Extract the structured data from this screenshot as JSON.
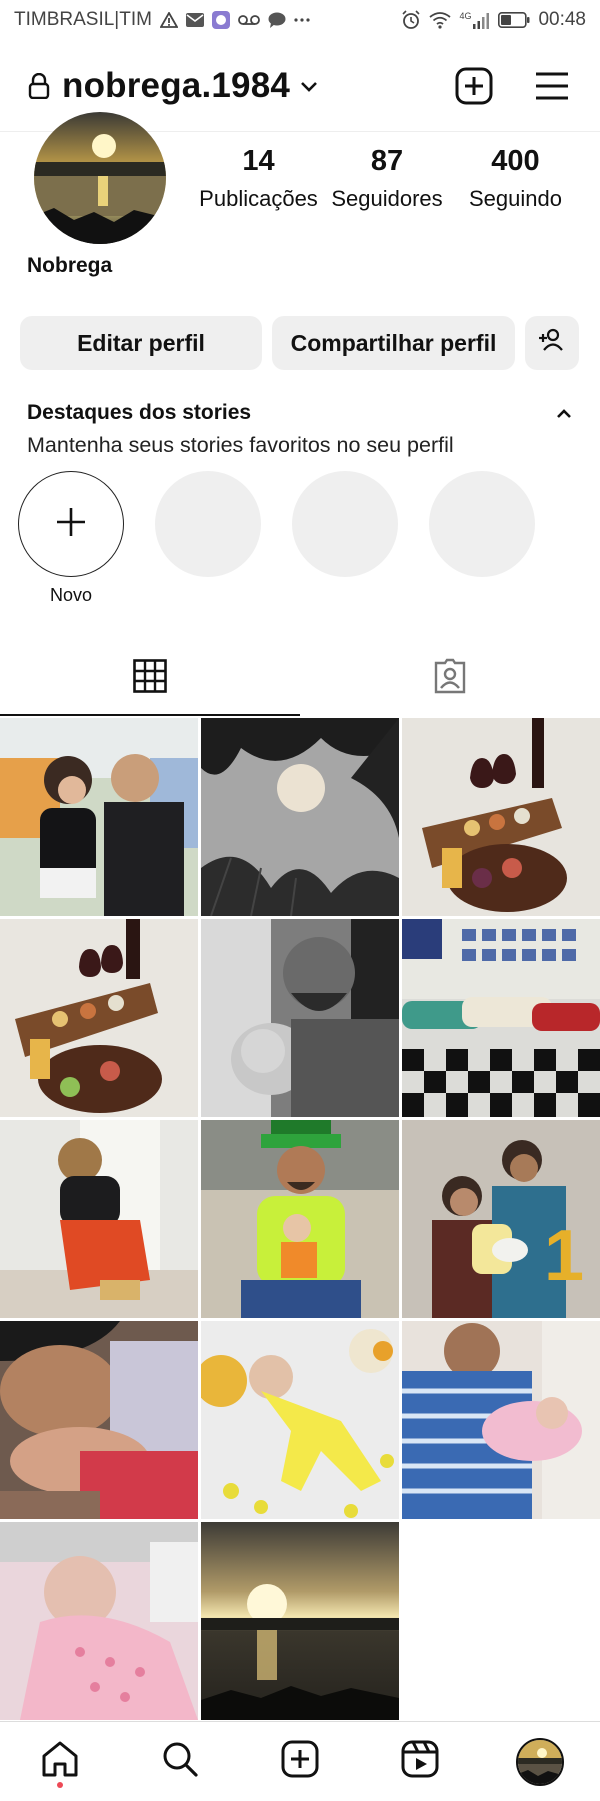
{
  "status_bar": {
    "carrier": "TIMBRASIL|TIM",
    "time": "00:48",
    "network": "4G",
    "icons": [
      "warning-icon",
      "mail-icon",
      "app-icon",
      "voicemail-icon",
      "chat-icon",
      "more-icon",
      "alarm-icon",
      "wifi-icon",
      "signal-icon",
      "battery-icon"
    ]
  },
  "header": {
    "username": "nobrega.1984",
    "icons": [
      "lock-icon",
      "chevron-down-icon",
      "new-post-icon",
      "menu-icon"
    ]
  },
  "profile": {
    "name": "Nobrega",
    "stats": [
      {
        "value": "14",
        "label": "Publicações"
      },
      {
        "value": "87",
        "label": "Seguidores"
      },
      {
        "value": "400",
        "label": "Seguindo"
      }
    ]
  },
  "buttons": {
    "edit": "Editar perfil",
    "share": "Compartilhar perfil"
  },
  "highlights": {
    "title": "Destaques dos stories",
    "subtitle": "Mantenha seus stories favoritos no seu perfil",
    "new_label": "Novo"
  },
  "tabs": [
    {
      "id": "grid",
      "icon": "grid-icon",
      "active": true
    },
    {
      "id": "tagged",
      "icon": "tagged-icon",
      "active": false
    }
  ],
  "posts": [
    {
      "desc": "father and daughter at playground"
    },
    {
      "desc": "full moon behind trees"
    },
    {
      "desc": "charcuterie board with wine"
    },
    {
      "desc": "charcuterie board with wine"
    },
    {
      "desc": "black and white father and baby"
    },
    {
      "desc": "classic car collection"
    },
    {
      "desc": "toddler at door"
    },
    {
      "desc": "man in green hat with baby"
    },
    {
      "desc": "family with birthday cake"
    },
    {
      "desc": "father holding sleeping baby"
    },
    {
      "desc": "baby in yellow outfit"
    },
    {
      "desc": "man holding newborn"
    },
    {
      "desc": "newborn sleeping"
    },
    {
      "desc": "sunset over the water"
    }
  ],
  "bottom_nav": {
    "items": [
      "home-icon",
      "search-icon",
      "create-icon",
      "reels-icon",
      "profile-avatar"
    ]
  }
}
